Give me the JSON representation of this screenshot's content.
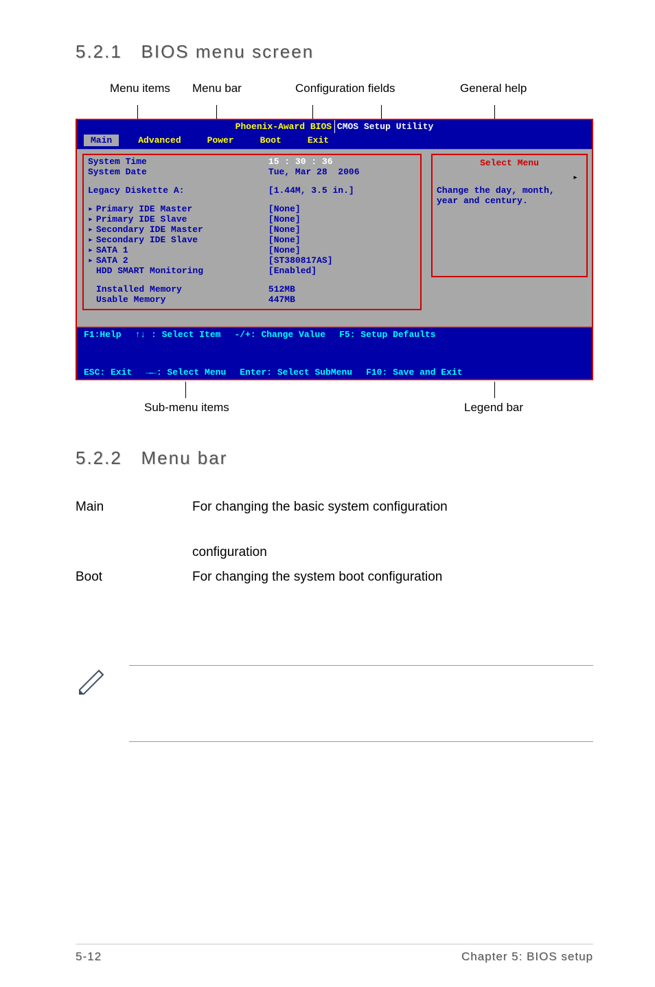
{
  "section1": {
    "number": "5.2.1",
    "title": "BIOS menu screen"
  },
  "callouts_top": {
    "menu_items": "Menu items",
    "menu_bar": "Menu bar",
    "config_fields": "Configuration fields",
    "general_help": "General help"
  },
  "bios": {
    "title_left": "Phoenix-Award BIOS",
    "title_right": " CMOS Setup Utility",
    "tabs": {
      "main": "Main",
      "advanced": "Advanced",
      "power": "Power",
      "boot": "Boot",
      "exit": "Exit"
    },
    "rows": {
      "sys_time_l": "System Time",
      "sys_time_v": "15 : 30 : 36",
      "sys_date_l": "System Date",
      "sys_date_v": "Tue, Mar 28  2006",
      "legacy_l": "Legacy Diskette A:",
      "legacy_v": "[1.44M, 3.5 in.]",
      "pim_l": "Primary IDE Master",
      "pim_v": "[None]",
      "pis_l": "Primary IDE Slave",
      "pis_v": "[None]",
      "sim_l": "Secondary IDE Master",
      "sim_v": "[None]",
      "sis_l": "Secondary IDE Slave",
      "sis_v": "[None]",
      "sata1_l": "SATA 1",
      "sata1_v": "[None]",
      "sata2_l": "SATA 2",
      "sata2_v": "[ST380817AS]",
      "hdd_l": "HDD SMART Monitoring",
      "hdd_v": "[Enabled]",
      "imem_l": "Installed Memory",
      "imem_v": "512MB",
      "umem_l": "Usable Memory",
      "umem_v": "447MB"
    },
    "help_box": {
      "title": "Select Menu",
      "arrow": "▸",
      "text1": "Change the day, month,",
      "text2": "year and century."
    },
    "legend": {
      "f1": "F1:Help",
      "sel_item": " : Select Item",
      "chg_val": "-/+: Change Value",
      "f5": "F5: Setup Defaults",
      "esc": "ESC: Exit",
      "sel_menu": ": Select Menu",
      "enter": "Enter: Select SubMenu",
      "f10": "F10: Save and Exit"
    }
  },
  "callouts_bottom": {
    "sub_menu": "Sub-menu items",
    "legend_bar": "Legend bar"
  },
  "section2": {
    "number": "5.2.2",
    "title": "Menu bar"
  },
  "desc": {
    "main_k": "Main",
    "main_v": "For changing the basic system configuration",
    "cfg_line": "configuration",
    "boot_k": "Boot",
    "boot_v": "For changing the system boot configuration"
  },
  "footer": {
    "page": "5-12",
    "chapter": "Chapter 5: BIOS setup"
  }
}
